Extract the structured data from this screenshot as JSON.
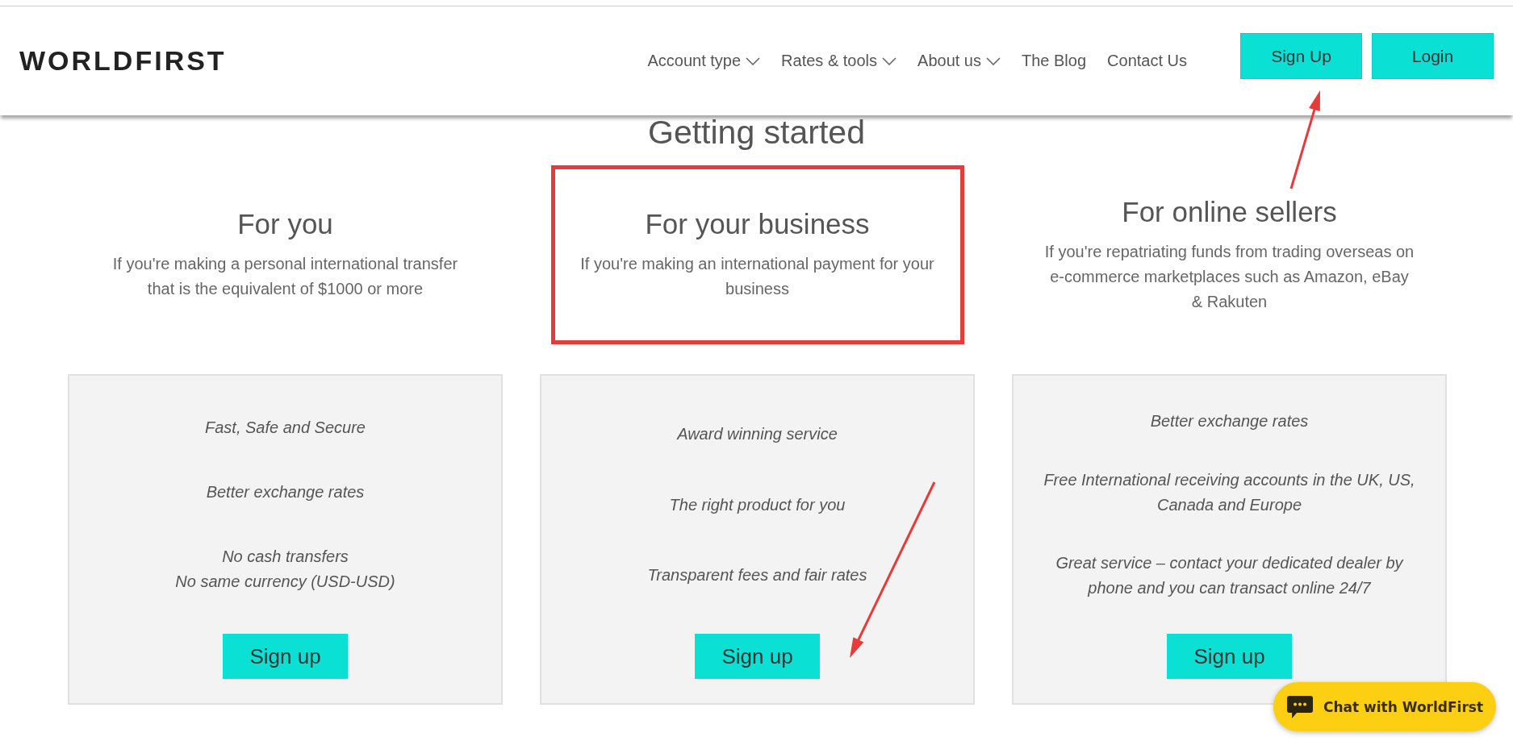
{
  "header": {
    "logo": "WORLDFIRST",
    "nav": [
      {
        "label": "Account type",
        "dropdown": true
      },
      {
        "label": "Rates & tools",
        "dropdown": true
      },
      {
        "label": "About us",
        "dropdown": true
      },
      {
        "label": "The Blog",
        "dropdown": false
      },
      {
        "label": "Contact Us",
        "dropdown": false
      }
    ],
    "buttons": [
      "Sign Up",
      "Login"
    ]
  },
  "title": "Getting started",
  "columns": [
    {
      "heading": "For you",
      "description": "If you're making a personal international transfer that is the equivalent of $1000 or more",
      "highlighted": false,
      "features": [
        "Fast, Safe and Secure",
        "Better exchange rates",
        "No cash transfers\nNo same currency (USD-USD)"
      ],
      "button": "Sign up"
    },
    {
      "heading": "For your business",
      "description": "If you're making an international payment for your business",
      "highlighted": true,
      "features": [
        "Award winning service",
        "The right product for you",
        "Transparent fees and fair rates"
      ],
      "button": "Sign up"
    },
    {
      "heading": "For online sellers",
      "description": "If you're repatriating funds from trading overseas on e-commerce marketplaces such as Amazon, eBay & Rakuten",
      "highlighted": false,
      "features": [
        "Better exchange rates",
        "Free International receiving accounts in the UK, US, Canada and Europe",
        "Great service – contact your dedicated dealer by phone and you can transact online 24/7"
      ],
      "button": "Sign up"
    }
  ],
  "chat": {
    "label": "Chat with WorldFirst"
  }
}
